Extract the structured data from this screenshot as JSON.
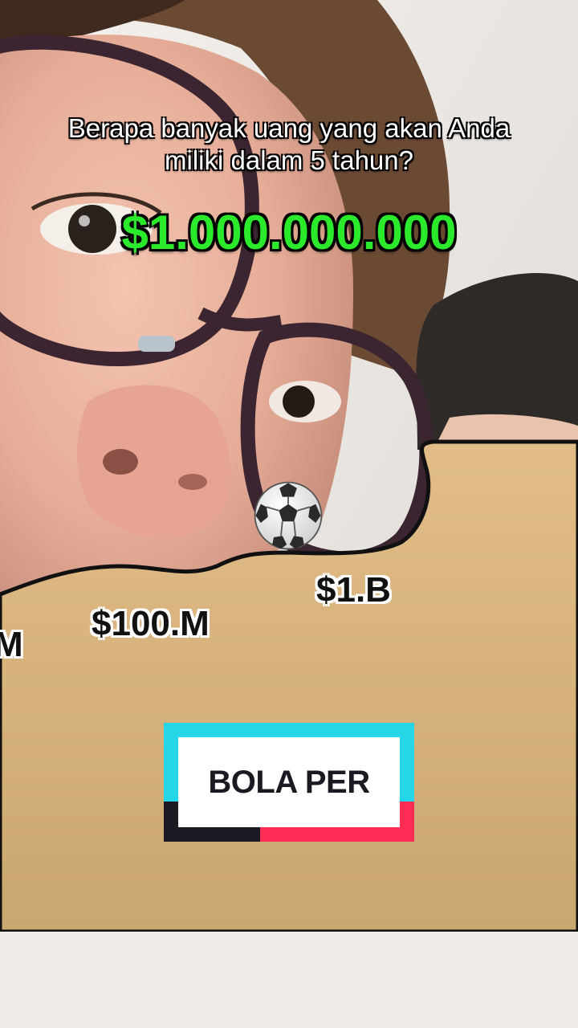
{
  "question": "Berapa banyak uang yang akan Anda miliki dalam 5 tahun?",
  "amount": "$1.000.000.000",
  "levels": {
    "left_cut": "M",
    "mid": "$100.M",
    "right": "$1.B"
  },
  "ball_icon": "soccer-ball-icon",
  "brand": {
    "label": "BOLA PER",
    "colors": {
      "cyan": "#25d5e8",
      "pink": "#ff2d55",
      "dark": "#1b1a22"
    }
  },
  "colors": {
    "amount_green": "#2bea2b",
    "floor": "#d9b27f"
  }
}
